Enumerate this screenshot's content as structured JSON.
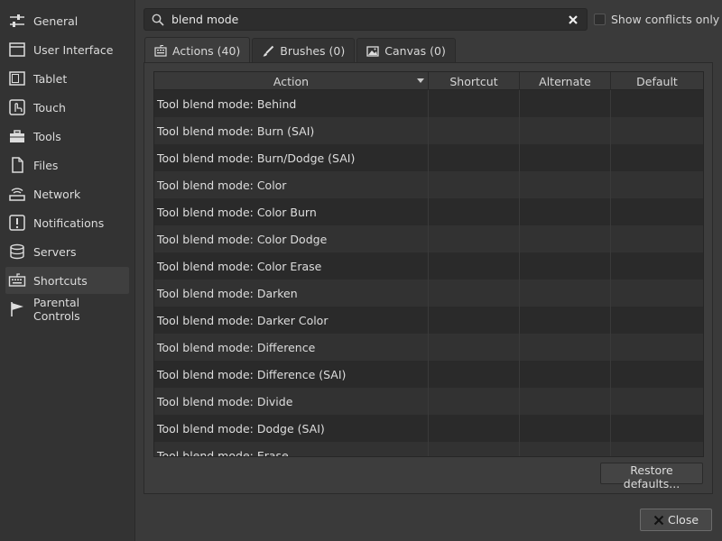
{
  "sidebar": {
    "items": [
      {
        "label": "General",
        "icon": "sliders-icon"
      },
      {
        "label": "User Interface",
        "icon": "window-icon"
      },
      {
        "label": "Tablet",
        "icon": "tablet-icon"
      },
      {
        "label": "Touch",
        "icon": "touch-icon"
      },
      {
        "label": "Tools",
        "icon": "toolbox-icon"
      },
      {
        "label": "Files",
        "icon": "file-icon"
      },
      {
        "label": "Network",
        "icon": "network-icon"
      },
      {
        "label": "Notifications",
        "icon": "notification-icon"
      },
      {
        "label": "Servers",
        "icon": "database-icon"
      },
      {
        "label": "Shortcuts",
        "icon": "keyboard-icon"
      },
      {
        "label": "Parental Controls",
        "icon": "flag-icon"
      }
    ],
    "selected": "Shortcuts"
  },
  "search": {
    "value": "blend mode"
  },
  "conflicts_label": "Show conflicts only",
  "tabs": [
    {
      "label": "Actions (40)",
      "icon": "actions-icon"
    },
    {
      "label": "Brushes (0)",
      "icon": "brush-icon"
    },
    {
      "label": "Canvas (0)",
      "icon": "image-icon"
    }
  ],
  "table": {
    "headers": [
      "Action",
      "Shortcut",
      "Alternate",
      "Default"
    ],
    "rows": [
      "Tool blend mode: Behind",
      "Tool blend mode: Burn (SAI)",
      "Tool blend mode: Burn/Dodge (SAI)",
      "Tool blend mode: Color",
      "Tool blend mode: Color Burn",
      "Tool blend mode: Color Dodge",
      "Tool blend mode: Color Erase",
      "Tool blend mode: Darken",
      "Tool blend mode: Darker Color",
      "Tool blend mode: Difference",
      "Tool blend mode: Difference (SAI)",
      "Tool blend mode: Divide",
      "Tool blend mode: Dodge (SAI)",
      "Tool blend mode: Erase"
    ]
  },
  "restore_label": "Restore defaults...",
  "close_label": "Close"
}
